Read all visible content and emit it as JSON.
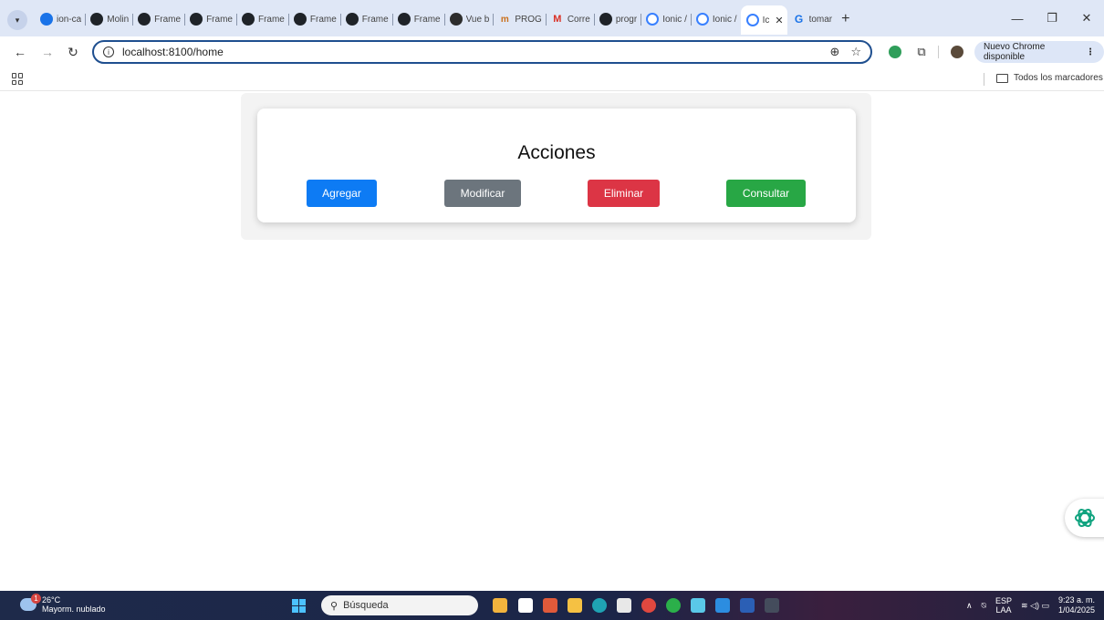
{
  "browser": {
    "tabs": [
      {
        "label": "ion-ca",
        "icon": "chrome-icon"
      },
      {
        "label": "Molin",
        "icon": "github-icon"
      },
      {
        "label": "Frame",
        "icon": "github-icon"
      },
      {
        "label": "Frame",
        "icon": "github-icon"
      },
      {
        "label": "Frame",
        "icon": "github-icon"
      },
      {
        "label": "Frame",
        "icon": "github-icon"
      },
      {
        "label": "Frame",
        "icon": "github-icon"
      },
      {
        "label": "Frame",
        "icon": "github-icon"
      },
      {
        "label": "Vue b",
        "icon": "vue-icon"
      },
      {
        "label": "PROG",
        "icon": "prog-icon"
      },
      {
        "label": "Corre",
        "icon": "gmail-icon"
      },
      {
        "label": "progr",
        "icon": "github-icon"
      },
      {
        "label": "Ionic /",
        "icon": "ionic-icon"
      },
      {
        "label": "Ionic /",
        "icon": "ionic-icon"
      },
      {
        "label": "Ic",
        "icon": "ionic-icon",
        "active": true
      },
      {
        "label": "tomar",
        "icon": "google-icon"
      }
    ],
    "url": "localhost:8100/home",
    "update_button": "Nuevo Chrome disponible",
    "bookmarks_all": "Todos los marcadores"
  },
  "page": {
    "title": "Acciones",
    "buttons": {
      "add": "Agregar",
      "modify": "Modificar",
      "delete": "Eliminar",
      "query": "Consultar"
    }
  },
  "taskbar": {
    "weather_temp": "26°C",
    "weather_desc": "Mayorm. nublado",
    "weather_badge": "1",
    "search_placeholder": "Búsqueda",
    "lang_top": "ESP",
    "lang_bottom": "LAA",
    "time": "9:23 a. m.",
    "date": "1/04/2025"
  },
  "colors": {
    "add": "#0d7bf4",
    "modify": "#6c757d",
    "delete": "#dc3545",
    "query": "#28a745"
  }
}
